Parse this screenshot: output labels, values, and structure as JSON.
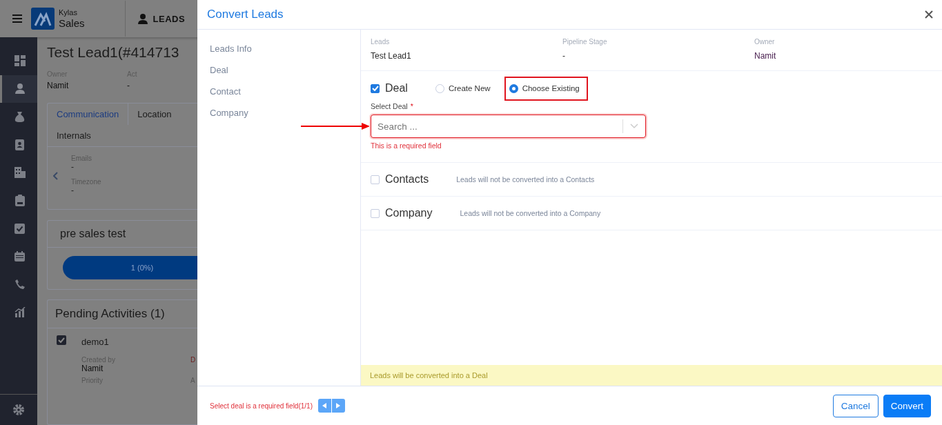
{
  "topbar": {
    "brand_top": "Kylas",
    "brand_bottom": "Sales",
    "section": "LEADS"
  },
  "sidebar": {
    "items": [
      {
        "kind": "dashboard",
        "selected": false
      },
      {
        "kind": "person",
        "selected": true
      },
      {
        "kind": "moneybag",
        "selected": false
      },
      {
        "kind": "card",
        "selected": false
      },
      {
        "kind": "building",
        "selected": false
      },
      {
        "kind": "clipboard",
        "selected": false
      },
      {
        "kind": "check",
        "selected": false
      },
      {
        "kind": "calendar",
        "selected": false
      },
      {
        "kind": "phone",
        "selected": false
      },
      {
        "kind": "chart",
        "selected": false
      }
    ]
  },
  "lead": {
    "title": "Test Lead1(#414713",
    "fields": [
      {
        "label": "Owner",
        "value": "Namit"
      },
      {
        "label": "Act",
        "value": "-"
      }
    ],
    "tabs": [
      {
        "label": "Communication",
        "selected": true
      },
      {
        "label": "Location",
        "selected": false
      },
      {
        "label": "Internals",
        "selected": false
      }
    ],
    "details": [
      {
        "label": "Emails",
        "value": "-"
      },
      {
        "label": "Timezone",
        "value": "-"
      }
    ],
    "pipeline": {
      "title": "pre sales test",
      "progress": "1 (0%)"
    },
    "activities": {
      "title": "Pending Activities (1)",
      "items": [
        {
          "name": "demo1",
          "checked": true,
          "created_label": "Created by",
          "created_value": "Namit",
          "due_label": "D",
          "priority_label": "Priority",
          "assigned_label": "A"
        }
      ]
    }
  },
  "modal": {
    "title": "Convert Leads",
    "nav": [
      "Leads Info",
      "Deal",
      "Contact",
      "Company"
    ],
    "summary": [
      {
        "label": "Leads",
        "value": "Test Lead1"
      },
      {
        "label": "Pipeline Stage",
        "value": "-"
      },
      {
        "label": "Owner",
        "value": "Namit"
      }
    ],
    "deal": {
      "label": "Deal",
      "checked": true,
      "options": [
        {
          "label": "Create New",
          "selected": false,
          "highlighted": false
        },
        {
          "label": "Choose Existing",
          "selected": true,
          "highlighted": true
        }
      ],
      "field_label": "Select Deal",
      "required_mark": "*",
      "placeholder": "Search ...",
      "error": "This is a required field"
    },
    "sections": [
      {
        "label": "Contacts",
        "checked": false,
        "note": "Leads will not be converted into a Contacts"
      },
      {
        "label": "Company",
        "checked": false,
        "note": "Leads will not be converted into a Company"
      }
    ],
    "banner": "Leads will be converted into a Deal",
    "footer": {
      "error": "Select deal is a required field(1/1)",
      "cancel": "Cancel",
      "convert": "Convert"
    }
  }
}
